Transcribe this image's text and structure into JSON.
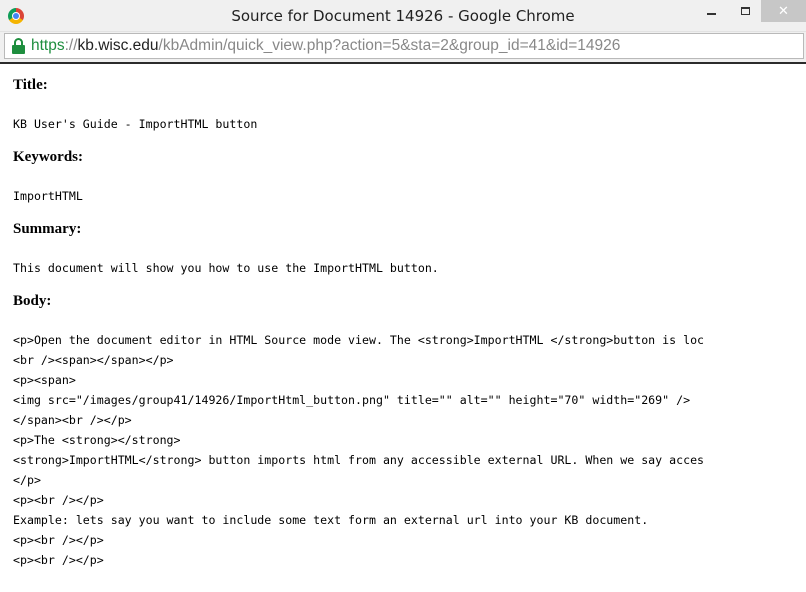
{
  "window": {
    "title": "Source for Document 14926 - Google Chrome",
    "close_symbol": "✕"
  },
  "address": {
    "scheme": "https",
    "separator": "://",
    "host": "kb.wisc.edu",
    "path": "/kbAdmin/quick_view.php?action=5&sta=2&group_id=41&id=14926"
  },
  "document": {
    "title_label": "Title:",
    "title_value": "KB User's Guide - ImportHTML button",
    "keywords_label": "Keywords:",
    "keywords_value": "ImportHTML",
    "summary_label": "Summary:",
    "summary_value": "This document will show you how to use the ImportHTML button.",
    "body_label": "Body:",
    "body_lines": [
      "<p>Open the document editor in HTML Source mode view. The <strong>ImportHTML </strong>button is loc",
      "<br /><span></span></p>",
      "<p><span>",
      "<img src=\"/images/group41/14926/ImportHtml_button.png\" title=\"\" alt=\"\" height=\"70\" width=\"269\" />",
      "</span><br /></p>",
      "<p>The <strong></strong>",
      "<strong>ImportHTML</strong> button imports html from any accessible external URL. When we say acces",
      "</p>",
      "<p><br /></p>",
      "Example: lets say you want to include some text form an external url into your KB document.",
      "<p><br /></p>",
      "<p><br /></p>"
    ]
  },
  "icons": {
    "app": "chrome-logo-icon",
    "secure": "lock-icon"
  }
}
